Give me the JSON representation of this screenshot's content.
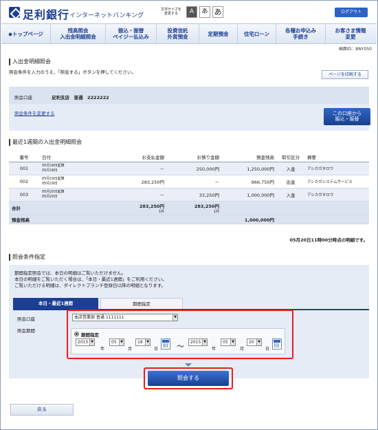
{
  "header": {
    "bank_name": "足利銀行",
    "service_name": "インターネットバンキング",
    "font_size_label": "文字サイズを変更する",
    "font_sizes": [
      "A",
      "あ",
      "あ"
    ],
    "logout": "ログアウト"
  },
  "nav": [
    {
      "label": "トップページ"
    },
    {
      "label": "残高照会\n入出金明細照会"
    },
    {
      "label": "振込・振替\nペイジー払込み"
    },
    {
      "label": "投資信託\n外貨預金"
    },
    {
      "label": "定期預金"
    },
    {
      "label": "住宅ローン"
    },
    {
      "label": "各種お申込み\n手続き"
    },
    {
      "label": "お客さま情報\n変更"
    }
  ],
  "screen_id": "画面ID：BNY050",
  "page_title": "入出金明細照会",
  "instruction": "照会条件を入力のうえ、「照会する」ボタンを押してください。",
  "print_button": "ページを印刷する",
  "account": {
    "label": "照会口座",
    "value": "足利支店　普通　2222222",
    "change_link": "照会条件を変更する",
    "transfer_button": "この口座から\n振込・振替"
  },
  "recent_title": "最近1週間の入出金明細照会",
  "table": {
    "headers": [
      "番号",
      "日付",
      "お支払金額",
      "お預り金額",
      "預金残高",
      "取引区分",
      "摘要"
    ],
    "rows": [
      {
        "no": "001",
        "date1": "05月18日起算",
        "date2": "05月18日",
        "pay": "－",
        "dep": "250,000円",
        "bal": "1,250,000円",
        "type": "入金",
        "memo": "アシカガタロウ"
      },
      {
        "no": "002",
        "date1": "05月19日起算",
        "date2": "05月19日",
        "pay": "283,250円",
        "dep": "－",
        "bal": "966,750円",
        "type": "出金",
        "memo": "アシカガシステムサービス"
      },
      {
        "no": "003",
        "date1": "05月20日起算",
        "date2": "05月20日",
        "pay": "－",
        "dep": "33,250円",
        "bal": "1,000,000円",
        "type": "入金",
        "memo": "アシカガタロウ"
      }
    ],
    "total": {
      "label": "合計",
      "pay": "283,250円",
      "pay_count": "1件",
      "dep": "283,250円",
      "dep_count": "1件"
    },
    "balance": {
      "label": "預金残高",
      "value": "1,000,000円"
    }
  },
  "as_of": "05月20日11時00分時点の明細です。",
  "cond_title": "照会条件指定",
  "note": "期間指定照会では、本日の明細はご覧いただけません。\n本日の明細をご覧いただく場合は、「本日・最近1週間」をご利用ください。\nご覧いただける明細は、ダイレクトプランチ登録日以降の明細となります。",
  "tabs": {
    "recent": "本日・最近1週間",
    "period": "期間指定"
  },
  "form": {
    "acct_label": "照会口座",
    "acct_value": "本店営業部 普通 1111111",
    "period_label": "照会期間",
    "radio_label": "期間指定",
    "from_year": "2015",
    "from_month": "05",
    "from_day": "18",
    "to_year": "2015",
    "to_month": "05",
    "to_day": "20",
    "unit_year": "年",
    "unit_month": "月",
    "unit_day": "日",
    "tilde": "～"
  },
  "submit": "照会する",
  "back": "戻る"
}
